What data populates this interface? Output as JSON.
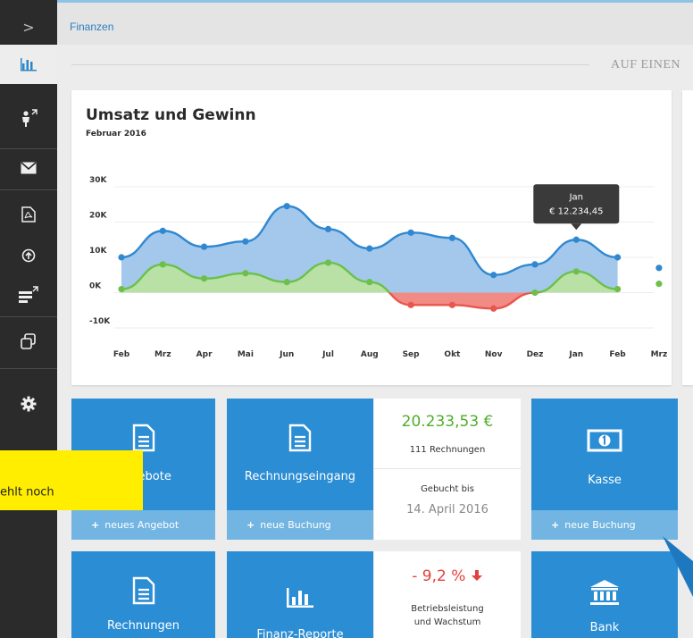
{
  "breadcrumb": "Finanzen",
  "section_title": "AUF EINEN",
  "sidebar": {
    "collapse_glyph": ">",
    "items": [
      "chart-bar-icon",
      "user-link-icon",
      "envelope-icon",
      "pdf-icon",
      "upload-icon",
      "list-link-icon",
      "copy-icon",
      "gear-icon"
    ]
  },
  "chart": {
    "title": "Umsatz und Gewinn",
    "subtitle": "Februar 2016",
    "tooltip_month": "Jan",
    "tooltip_value": "€ 12.234,45"
  },
  "chart_data": {
    "type": "area",
    "title": "Umsatz und Gewinn",
    "subtitle": "Februar 2016",
    "categories": [
      "Feb",
      "Mrz",
      "Apr",
      "Mai",
      "Jun",
      "Jul",
      "Aug",
      "Sep",
      "Okt",
      "Nov",
      "Dez",
      "Jan",
      "Feb",
      "Mrz"
    ],
    "y_ticks": [
      "30K",
      "20K",
      "10K",
      "0K",
      "-10K"
    ],
    "ylim": [
      -10000,
      30000
    ],
    "series": [
      {
        "color": "#2f88d0",
        "values": [
          10000,
          17500,
          13000,
          14500,
          24500,
          18000,
          12500,
          17000,
          15500,
          5000,
          8000,
          15000,
          10000,
          7000
        ]
      },
      {
        "color": "#6cc04a",
        "values": [
          1000,
          8000,
          4000,
          5500,
          3000,
          8500,
          3000,
          -3500,
          -3500,
          -4500,
          0,
          6000,
          1000,
          2500
        ]
      }
    ],
    "grid": true,
    "tooltip": {
      "category": "Jan",
      "value": "€ 12.234,45"
    }
  },
  "tiles": {
    "angebote": {
      "label": "Angebote",
      "action": "neues Angebot"
    },
    "rechnungseingang": {
      "label": "Rechnungseingang",
      "action": "neue Buchung"
    },
    "kasse": {
      "label": "Kasse",
      "action": "neue Buchung"
    },
    "rechnungen": {
      "label": "Rechnungen"
    },
    "finanz_reporte": {
      "label": "Finanz-Reporte"
    },
    "bank": {
      "label": "Bank"
    }
  },
  "stats": {
    "total_amount": "20.233,53 €",
    "invoice_count": "111 Rechnungen",
    "booked_label": "Gebucht bis",
    "booked_date": "14. April 2016",
    "change_value": "- 9,2 %",
    "change_desc_line1": "Betriebsleistung",
    "change_desc_line2": "und Wachstum"
  },
  "note": {
    "text": "ehlt noch"
  },
  "colors": {
    "accent": "#2b8dd4",
    "accent_light": "#72b5e3",
    "sidebar": "#2b2b2b",
    "revenue": "#2f88d0",
    "profit": "#6cc04a",
    "loss": "#e8574e",
    "positive_text": "#4fae2b",
    "negative_text": "#e2423a",
    "note": "#ffee00"
  }
}
